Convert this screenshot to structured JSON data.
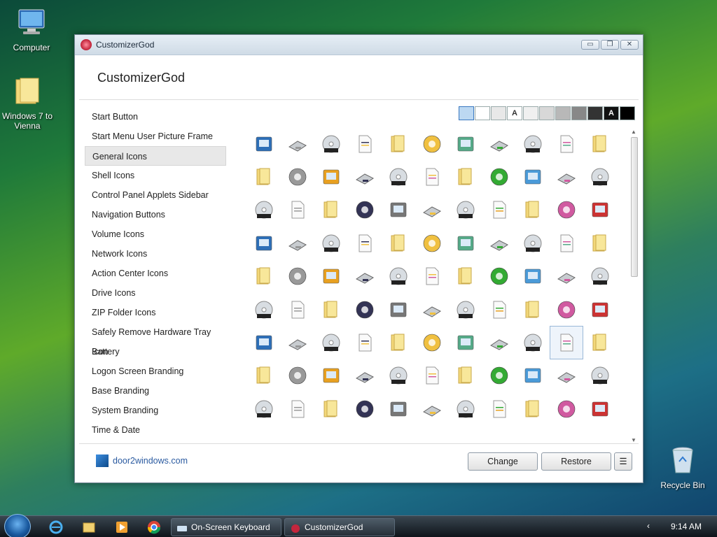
{
  "desktop": {
    "icons": [
      {
        "label": "Computer"
      },
      {
        "label": "Windows 7 to Vienna"
      },
      {
        "label": "Recycle Bin"
      }
    ]
  },
  "window": {
    "title": "CustomizerGod",
    "controls": {
      "minimize": "▭",
      "restore": "❐",
      "close": "✕"
    },
    "header": "CustomizerGod",
    "sidebar": [
      "Start Button",
      "Start Menu User Picture Frame",
      "General Icons",
      "Shell Icons",
      "Control Panel Applets Sidebar",
      "Navigation Buttons",
      "Volume Icons",
      "Network Icons",
      "Action Center Icons",
      "Drive Icons",
      "ZIP Folder Icons",
      "Safely Remove Hardware Tray Icon",
      "Battery",
      "Logon Screen Branding",
      "Base Branding",
      "System Branding",
      "Time & Date"
    ],
    "active_item": "General Icons",
    "swatches": [
      {
        "color": "#bcd8f2",
        "label": ""
      },
      {
        "color": "#ffffff",
        "label": ""
      },
      {
        "color": "#e8e8e8",
        "label": ""
      },
      {
        "color": "#ffffff",
        "label": "A"
      },
      {
        "color": "#f0f0f0",
        "label": ""
      },
      {
        "color": "#d8d8d8",
        "label": ""
      },
      {
        "color": "#b8b8b8",
        "label": ""
      },
      {
        "color": "#888888",
        "label": ""
      },
      {
        "color": "#333333",
        "label": ""
      },
      {
        "color": "#111111",
        "label": "A"
      },
      {
        "color": "#000000",
        "label": ""
      }
    ],
    "footer_link": "door2windows.com",
    "buttons": {
      "change": "Change",
      "restore": "Restore",
      "menu": "☰"
    }
  },
  "taskbar": {
    "tasks": [
      {
        "label": "On-Screen Keyboard"
      },
      {
        "label": "CustomizerGod"
      }
    ],
    "clock": "9:14 AM",
    "tray_arrow": "‹"
  },
  "icon_palette": [
    "#2d6fb8",
    "#4a9ad8",
    "#f0c040",
    "#e8a020",
    "#c33",
    "#3a3",
    "#777",
    "#999",
    "#d05aa0",
    "#5a8",
    "#335"
  ]
}
